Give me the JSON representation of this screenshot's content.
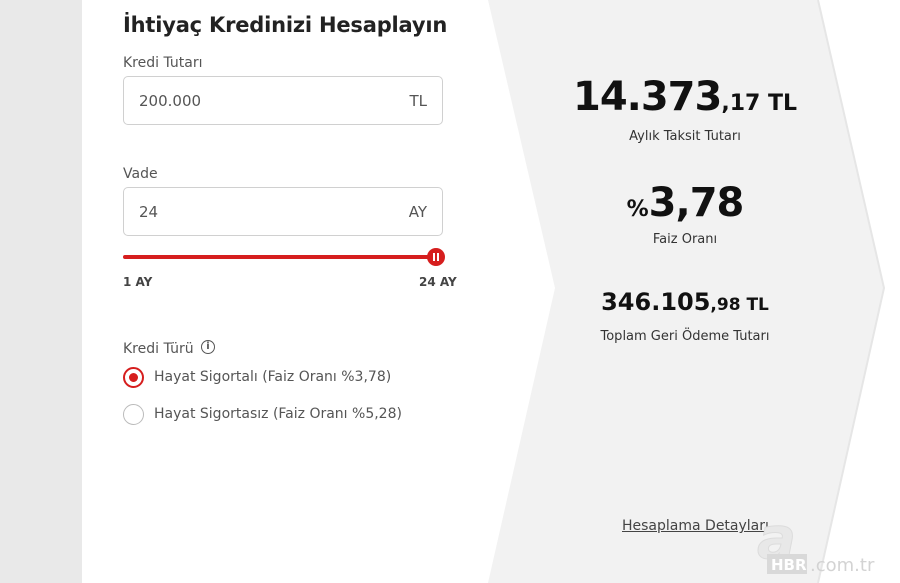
{
  "form": {
    "title": "İhtiyaç Kredinizi Hesaplayın",
    "amount_label": "Kredi Tutarı",
    "amount_value": "200.000",
    "amount_suffix": "TL",
    "term_label": "Vade",
    "term_value": "24",
    "term_suffix": "AY",
    "slider_min": "1 AY",
    "slider_max": "24 AY",
    "slider_level": 1.0,
    "credit_type_label": "Kredi Türü",
    "info_icon": "info-icon",
    "options": [
      {
        "label": "Hayat Sigortalı (Faiz Oranı %3,78)",
        "checked": true
      },
      {
        "label": "Hayat Sigortasız (Faiz Oranı %5,28)",
        "checked": false
      }
    ]
  },
  "results": {
    "installment_main": "14.373",
    "installment_small": ",17 TL",
    "installment_label": "Aylık Taksit Tutarı",
    "rate_prefix": "%",
    "rate_value": "3,78",
    "rate_label": "Faiz Oranı",
    "total_main": "346.105",
    "total_small": ",98 TL",
    "total_label": "Toplam Geri Ödeme Tutarı",
    "details_link": "Hesaplama Detayları"
  },
  "watermark": {
    "letter": "a",
    "badge": "HBR",
    "domain": ".com.tr"
  },
  "colors": {
    "accent": "#d61e1e",
    "panel": "#f2f2f2",
    "strip": "#e9e9e9"
  }
}
